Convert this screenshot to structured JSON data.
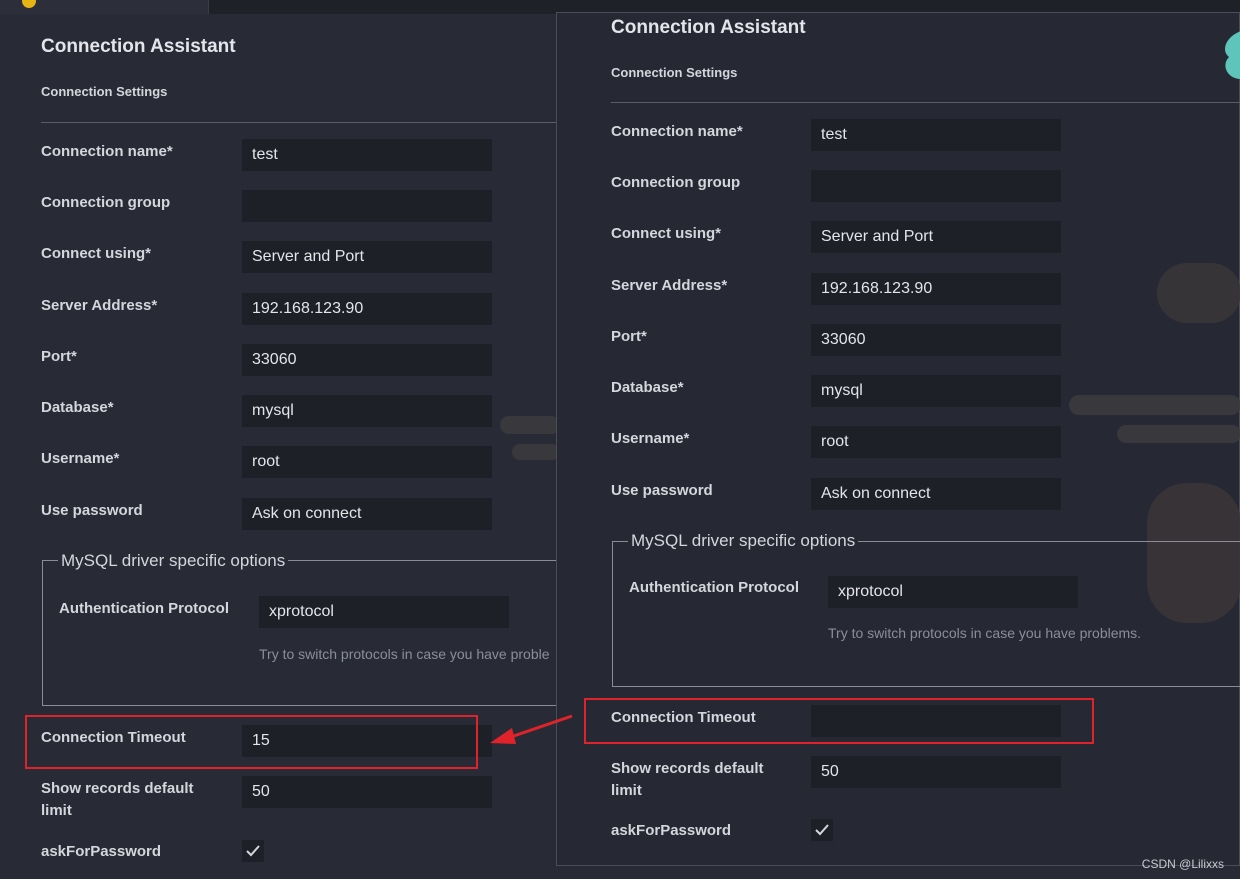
{
  "panel_left": {
    "title": "Connection Assistant",
    "section": "Connection Settings",
    "fields": [
      {
        "label": "Connection name*",
        "value": "test"
      },
      {
        "label": "Connection group",
        "value": ""
      },
      {
        "label": "Connect using*",
        "value": "Server and Port"
      },
      {
        "label": "Server Address*",
        "value": "192.168.123.90"
      },
      {
        "label": "Port*",
        "value": "33060"
      },
      {
        "label": "Database*",
        "value": "mysql"
      },
      {
        "label": "Username*",
        "value": "root"
      },
      {
        "label": "Use password",
        "value": "Ask on connect"
      }
    ],
    "driver_group": {
      "title": "MySQL driver specific options",
      "auth_label": "Authentication Protocol",
      "auth_value": "xprotocol",
      "hint": "Try to switch protocols in case you have proble"
    },
    "timeout": {
      "label": "Connection Timeout",
      "value": "15"
    },
    "records_limit": {
      "label": "Show records default limit",
      "value": "50"
    },
    "ask_password": {
      "label": "askForPassword",
      "checked": true
    }
  },
  "panel_right": {
    "title": "Connection Assistant",
    "section": "Connection Settings",
    "fields": [
      {
        "label": "Connection name*",
        "value": "test"
      },
      {
        "label": "Connection group",
        "value": ""
      },
      {
        "label": "Connect using*",
        "value": "Server and Port"
      },
      {
        "label": "Server Address*",
        "value": "192.168.123.90"
      },
      {
        "label": "Port*",
        "value": "33060"
      },
      {
        "label": "Database*",
        "value": "mysql"
      },
      {
        "label": "Username*",
        "value": "root"
      },
      {
        "label": "Use password",
        "value": "Ask on connect"
      }
    ],
    "driver_group": {
      "title": "MySQL driver specific options",
      "auth_label": "Authentication Protocol",
      "auth_value": "xprotocol",
      "hint": "Try to switch protocols in case you have problems."
    },
    "timeout": {
      "label": "Connection Timeout",
      "value": ""
    },
    "records_limit": {
      "label": "Show records default limit",
      "value": "50"
    },
    "ask_password": {
      "label": "askForPassword",
      "checked": true
    }
  },
  "annotation_color": "#e0232a",
  "watermark": "CSDN @Lilixxs"
}
